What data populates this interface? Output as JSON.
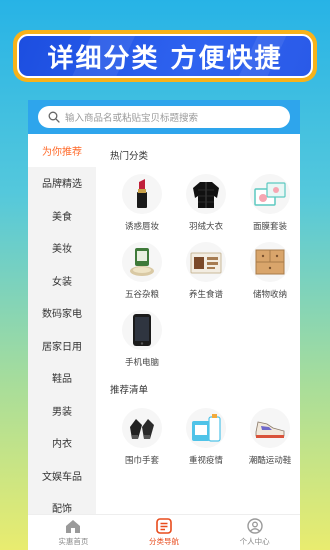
{
  "banner": {
    "text": "详细分类  方便快捷"
  },
  "search": {
    "placeholder": "输入商品名或粘贴宝贝标题搜索"
  },
  "sidebar": {
    "items": [
      {
        "label": "为你推荐",
        "active": true
      },
      {
        "label": "品牌精选"
      },
      {
        "label": "美食"
      },
      {
        "label": "美妆"
      },
      {
        "label": "女装"
      },
      {
        "label": "数码家电"
      },
      {
        "label": "居家日用"
      },
      {
        "label": "鞋品"
      },
      {
        "label": "男装"
      },
      {
        "label": "内衣"
      },
      {
        "label": "文娱车品"
      },
      {
        "label": "配饰"
      }
    ]
  },
  "hot": {
    "title": "热门分类",
    "items": [
      {
        "label": "诱惑唇妆",
        "icon": "lipstick-icon"
      },
      {
        "label": "羽绒大衣",
        "icon": "down-jacket-icon"
      },
      {
        "label": "面膜套装",
        "icon": "face-mask-icon"
      },
      {
        "label": "五谷杂粮",
        "icon": "grain-icon"
      },
      {
        "label": "养生食谱",
        "icon": "health-food-icon"
      },
      {
        "label": "储物收纳",
        "icon": "storage-cabinet-icon"
      },
      {
        "label": "手机电脑",
        "icon": "phone-icon"
      }
    ]
  },
  "recommend": {
    "title": "推荐清单",
    "items": [
      {
        "label": "围巾手套",
        "icon": "gloves-icon"
      },
      {
        "label": "重视疫情",
        "icon": "disinfectant-icon"
      },
      {
        "label": "潮酷运动鞋",
        "icon": "sneaker-icon"
      }
    ]
  },
  "tabbar": {
    "items": [
      {
        "label": "实惠首页",
        "icon": "home-icon"
      },
      {
        "label": "分类导航",
        "icon": "category-icon",
        "active": true
      },
      {
        "label": "个人中心",
        "icon": "user-icon"
      }
    ]
  },
  "colors": {
    "accent": "#ff6a2a",
    "search_bar": "#2ea5ec",
    "banner_blue": "#2f63f0",
    "banner_border": "#f7b21a"
  }
}
